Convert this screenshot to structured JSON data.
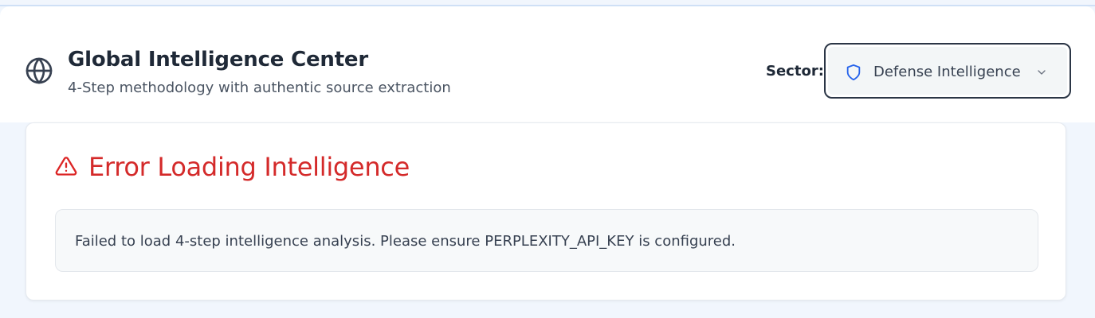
{
  "header": {
    "icon": "globe-icon",
    "title": "Global Intelligence Center",
    "subtitle": "4-Step methodology with authentic source extraction",
    "sector_label": "Sector:",
    "sector_select": {
      "icon": "shield-icon",
      "value": "Defense Intelligence",
      "chevron": "chevron-down-icon"
    }
  },
  "error": {
    "icon": "alert-triangle-icon",
    "title": "Error Loading Intelligence",
    "message": "Failed to load 4-step intelligence analysis. Please ensure PERPLEXITY_API_KEY is configured."
  },
  "colors": {
    "page_background": "#f1f6fd",
    "error_red": "#d42a2a",
    "shield_blue": "#2563eb",
    "select_border": "#2b3646"
  }
}
